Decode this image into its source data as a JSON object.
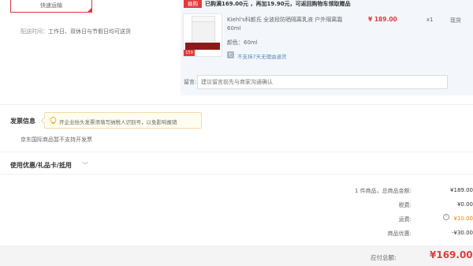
{
  "shipping": {
    "option_label": "快速运输",
    "delivery_label": "配送时间：",
    "delivery_value": "工作日、双休日与节假日均可送货"
  },
  "gift": {
    "tag": "换购",
    "promo": "已购满169.00元 ，再加19.90元，可返回购物车领取赠品"
  },
  "product": {
    "badge": "159",
    "name": "Kiehl's科颜氏 全波段防晒隔离乳液 户外隔离霜 60ml",
    "price": "¥ 189.00",
    "qty": "x1",
    "stock": "现货",
    "color_label": "颜色：",
    "color_value": "60ml",
    "return_icon": "七",
    "return_text": "不支持7天无理由退货"
  },
  "note": {
    "label": "留言:",
    "placeholder": "建议留言前先与商家沟通确认"
  },
  "invoice": {
    "title": "发票信息",
    "hint": "开企业抬头发票须填写纳税人识别号，以免影响报销",
    "note": "京东国际商品暂不支持开发票"
  },
  "coupon": {
    "label": "使用优惠/礼品卡/抵用",
    "chevron": "﹀"
  },
  "summary": {
    "items_label": "1 件商品，总商品金额:",
    "items_value": "¥189.00",
    "tax_label": "税费:",
    "tax_value": "¥0.00",
    "freight_label": "运费:",
    "freight_value": "¥10.00",
    "freight_icon": "!",
    "discount_label": "商品优惠:",
    "discount_value": "-¥30.00",
    "total_label": "应付总额:",
    "total_value": "¥169.00"
  },
  "colors": {
    "accent_red": "#e4393c",
    "panel_bg": "#f3f7fc",
    "orange": "#f08200"
  }
}
